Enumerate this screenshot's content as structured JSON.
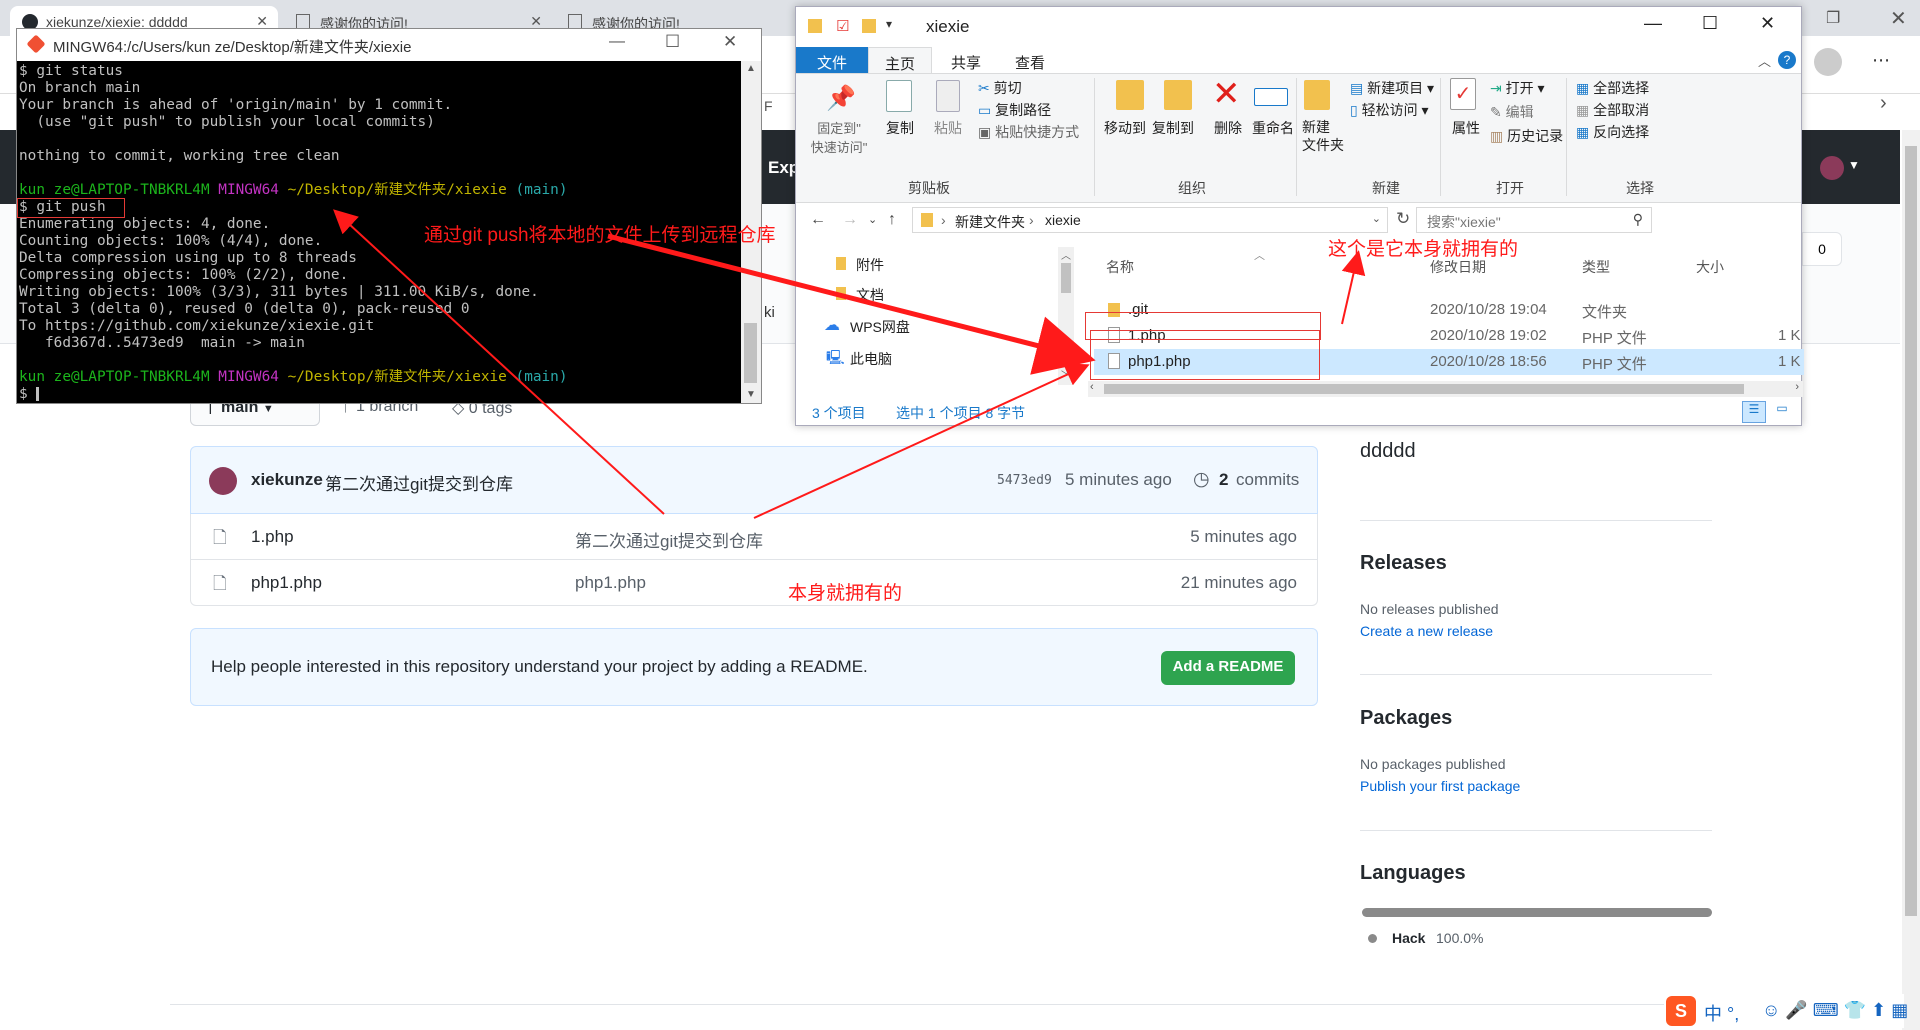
{
  "chrome": {
    "tabs": [
      {
        "title": "xiekunze/xiexie: ddddd",
        "active": true
      },
      {
        "title": "感谢你的访问!",
        "active": false
      },
      {
        "title": "感谢你的访问!",
        "active": false
      }
    ],
    "right_fragment": "Exp",
    "left_fragment_f": "F",
    "left_fragment_ki": "ki"
  },
  "terminal": {
    "title": "MINGW64:/c/Users/kun ze/Desktop/新建文件夹/xiexie",
    "lines": [
      {
        "text": "$ git status",
        "color": "default"
      },
      {
        "text": "On branch main",
        "color": "default"
      },
      {
        "text": "Your branch is ahead of 'origin/main' by 1 commit.",
        "color": "default"
      },
      {
        "text": "  (use \"git push\" to publish your local commits)",
        "color": "default"
      },
      {
        "text": "",
        "color": "default"
      },
      {
        "text": "nothing to commit, working tree clean",
        "color": "default"
      },
      {
        "text": "",
        "color": "default"
      }
    ],
    "prompt1": {
      "user": "kun ze@LAPTOP-TNBKRL4M",
      "shell": "MINGW64",
      "path": "~/Desktop/新建文件夹/xiexie",
      "branch": "(main)"
    },
    "command": "$ git push",
    "output": [
      "Enumerating objects: 4, done.",
      "Counting objects: 100% (4/4), done.",
      "Delta compression using up to 8 threads",
      "Compressing objects: 100% (2/2), done.",
      "Writing objects: 100% (3/3), 311 bytes | 311.00 KiB/s, done.",
      "Total 3 (delta 0), reused 0 (delta 0), pack-reused 0",
      "To https://github.com/xiekunze/xiexie.git",
      "   f6d367d..5473ed9  main -> main"
    ],
    "prompt2": {
      "user": "kun ze@LAPTOP-TNBKRL4M",
      "shell": "MINGW64",
      "path": "~/Desktop/新建文件夹/xiexie",
      "branch": "(main)"
    },
    "final": "$ "
  },
  "explorer": {
    "title": "xiexie",
    "tabs": [
      "文件",
      "主页",
      "共享",
      "查看"
    ],
    "ribbon": {
      "clipboard": {
        "pin": "固定到\"\n快速访问\"",
        "copy": "复制",
        "paste": "粘贴",
        "cut": "剪切",
        "copy_path": "复制路径",
        "paste_shortcut": "粘贴快捷方式",
        "label": "剪贴板"
      },
      "organize": {
        "move_to": "移动到",
        "copy_to": "复制到",
        "delete": "删除",
        "rename": "重命名",
        "label": "组织"
      },
      "new": {
        "new_folder": "新建\n文件夹",
        "new_item": "新建项目",
        "easy_access": "轻松访问",
        "label": "新建"
      },
      "open": {
        "properties": "属性",
        "open": "打开",
        "edit": "编辑",
        "history": "历史记录",
        "label": "打开"
      },
      "select": {
        "select_all": "全部选择",
        "select_none": "全部取消",
        "invert": "反向选择",
        "label": "选择"
      }
    },
    "breadcrumb": [
      "新建文件夹",
      "xiexie"
    ],
    "search_placeholder": "搜索\"xiexie\"",
    "nav": [
      "附件",
      "文档",
      "WPS网盘",
      "此电脑"
    ],
    "columns": [
      "名称",
      "修改日期",
      "类型",
      "大小"
    ],
    "files": [
      {
        "name": ".git",
        "date": "2020/10/28 19:04",
        "type": "文件夹",
        "size": "",
        "selected": false,
        "folder": true
      },
      {
        "name": "1.php",
        "date": "2020/10/28 19:02",
        "type": "PHP 文件",
        "size": "1 K",
        "selected": false,
        "folder": false
      },
      {
        "name": "php1.php",
        "date": "2020/10/28 18:56",
        "type": "PHP 文件",
        "size": "1 K",
        "selected": true,
        "folder": false
      }
    ],
    "status_count": "3 个项目",
    "status_selected": "选中 1 个项目 8 字节"
  },
  "github": {
    "branch": "main",
    "branches": "1 branch",
    "tags": "0 tags",
    "count_badge": "0",
    "commit": {
      "author": "xiekunze",
      "message": "第二次通过git提交到仓库",
      "sha": "5473ed9",
      "time": "5 minutes ago",
      "commits_count": "2",
      "commits_label": "commits"
    },
    "files": [
      {
        "name": "1.php",
        "message": "第二次通过git提交到仓库",
        "time": "5 minutes ago"
      },
      {
        "name": "php1.php",
        "message": "php1.php",
        "time": "21 minutes ago"
      }
    ],
    "readme": {
      "text": "Help people interested in this repository understand your project by adding a README.",
      "button": "Add a README"
    },
    "about": "ddddd",
    "releases": {
      "title": "Releases",
      "none": "No releases published",
      "link": "Create a new release"
    },
    "packages": {
      "title": "Packages",
      "none": "No packages published",
      "link": "Publish your first package"
    },
    "languages": {
      "title": "Languages",
      "name": "Hack",
      "percent": "100.0%"
    }
  },
  "annotations": {
    "push": "通过git push将本地的文件上传到远程仓库",
    "own_right": "这个是它本身就拥有的",
    "own_bottom": "本身就拥有的"
  },
  "ime": {
    "text": "中 °,"
  },
  "colors": {
    "red": "#ff1a1a",
    "gh_green": "#2ea44f",
    "term_green": "#1cb51c"
  }
}
